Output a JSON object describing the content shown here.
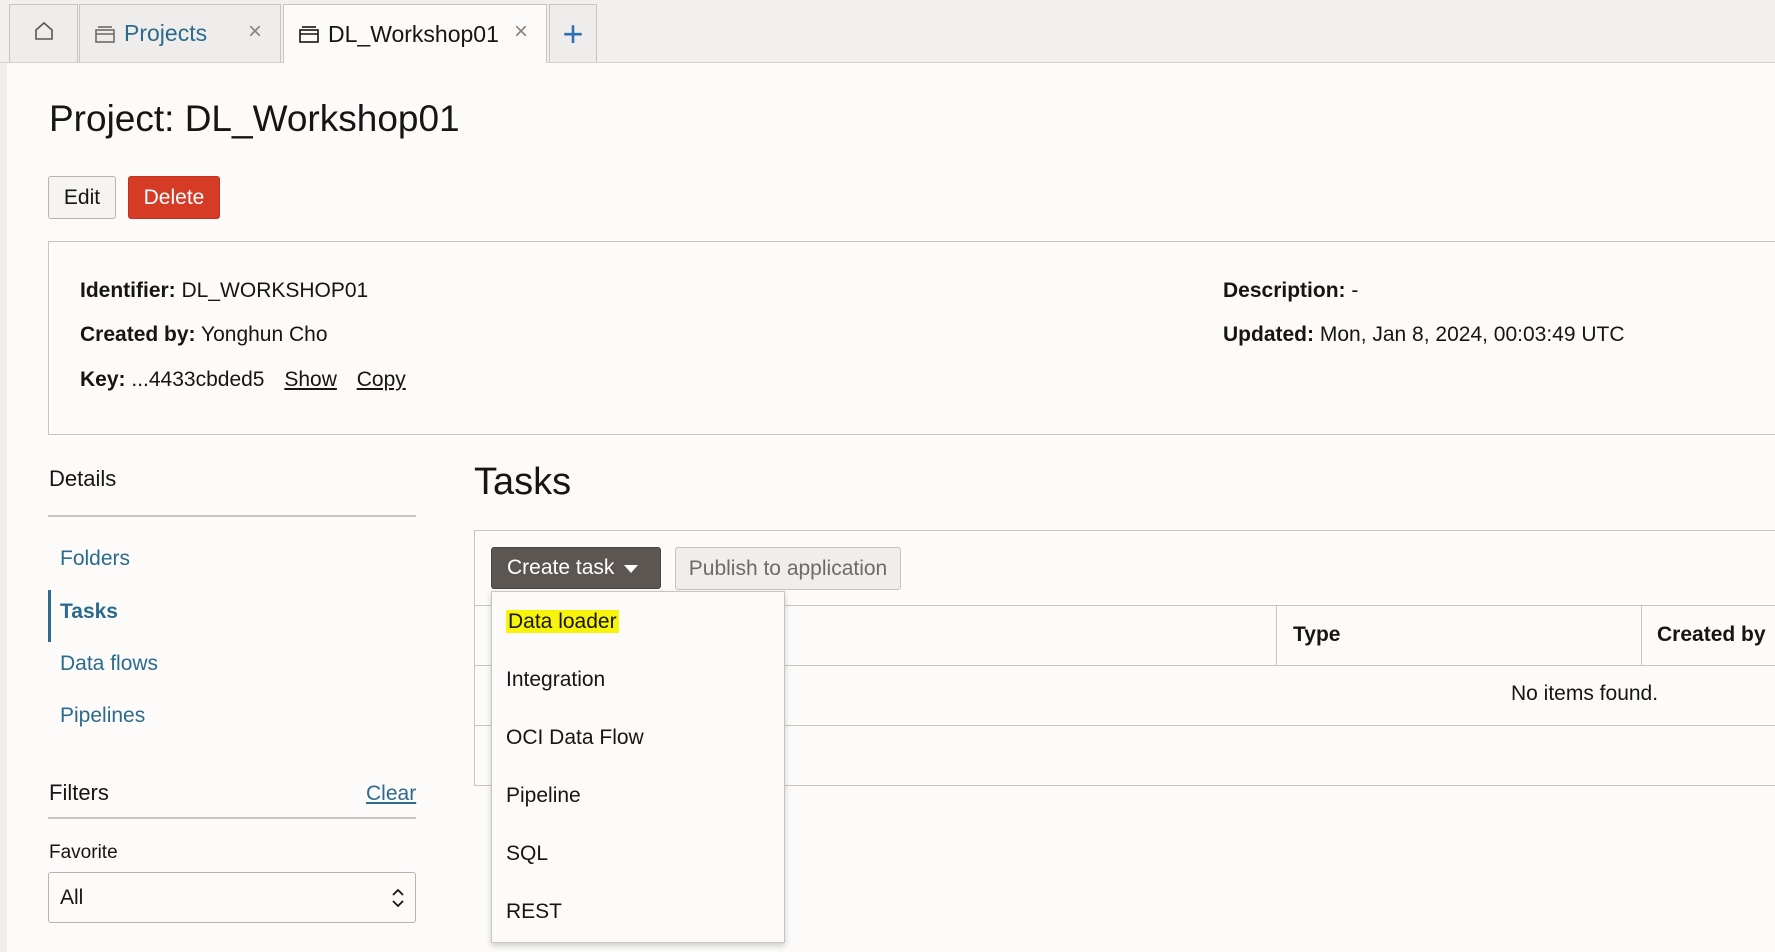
{
  "tabs": {
    "projects_label": "Projects",
    "workspace_label": "DL_Workshop01"
  },
  "page": {
    "title": "Project: DL_Workshop01",
    "edit_label": "Edit",
    "delete_label": "Delete"
  },
  "info": {
    "identifier_label": "Identifier:",
    "identifier_value": "DL_WORKSHOP01",
    "created_by_label": "Created by:",
    "created_by_value": "Yonghun Cho",
    "key_label": "Key:",
    "key_value": "...4433cbded5",
    "show_label": "Show",
    "copy_label": "Copy",
    "description_label": "Description:",
    "description_value": "-",
    "updated_label": "Updated:",
    "updated_value": "Mon, Jan 8, 2024, 00:03:49 UTC"
  },
  "sidebar": {
    "details_label": "Details",
    "items": [
      {
        "label": "Folders"
      },
      {
        "label": "Tasks",
        "active": true
      },
      {
        "label": "Data flows"
      },
      {
        "label": "Pipelines"
      }
    ],
    "filters_label": "Filters",
    "clear_label": "Clear",
    "favorite_label": "Favorite",
    "favorite_value": "All"
  },
  "tasks": {
    "title": "Tasks",
    "create_label": "Create task",
    "publish_label": "Publish to application",
    "columns": [
      "Type",
      "Created by"
    ],
    "empty_text": "No items found.",
    "menu": [
      {
        "label": "Data loader",
        "highlighted": true
      },
      {
        "label": "Integration"
      },
      {
        "label": "OCI Data Flow"
      },
      {
        "label": "Pipeline"
      },
      {
        "label": "SQL"
      },
      {
        "label": "REST"
      }
    ]
  },
  "colors": {
    "delete": "#d63b25",
    "link": "#2c6b8d",
    "highlight": "#f7f30a"
  }
}
